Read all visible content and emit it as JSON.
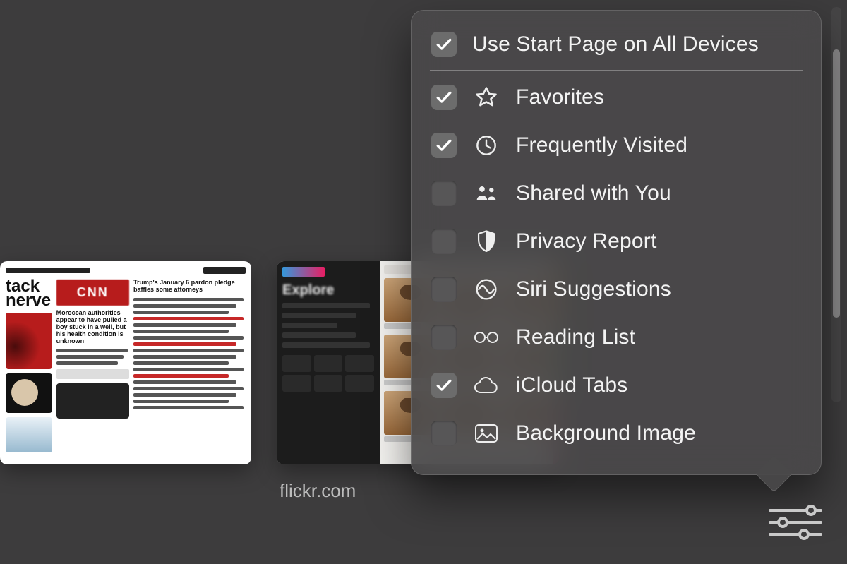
{
  "thumbnails": [
    {
      "caption": ""
    },
    {
      "caption": "flickr.com"
    }
  ],
  "popover": {
    "header": {
      "label": "Use Start Page on All Devices",
      "checked": true
    },
    "items": [
      {
        "icon": "star-icon",
        "label": "Favorites",
        "checked": true
      },
      {
        "icon": "clock-icon",
        "label": "Frequently Visited",
        "checked": true
      },
      {
        "icon": "people-icon",
        "label": "Shared with You",
        "checked": false
      },
      {
        "icon": "shield-icon",
        "label": "Privacy Report",
        "checked": false
      },
      {
        "icon": "siri-icon",
        "label": "Siri Suggestions",
        "checked": false
      },
      {
        "icon": "glasses-icon",
        "label": "Reading List",
        "checked": false
      },
      {
        "icon": "cloud-icon",
        "label": "iCloud Tabs",
        "checked": true
      },
      {
        "icon": "image-icon",
        "label": "Background Image",
        "checked": false
      }
    ]
  }
}
